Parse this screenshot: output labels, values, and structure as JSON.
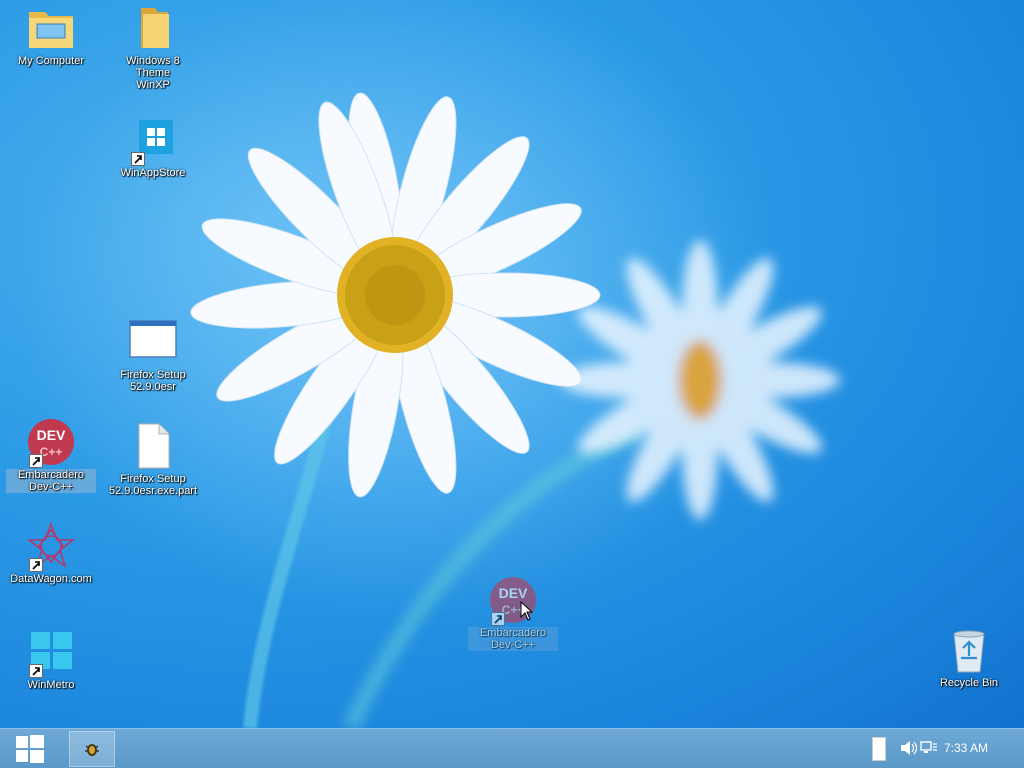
{
  "desktop": {
    "icons": {
      "my_computer": "My Computer",
      "win8_theme_line1": "Windows 8 Theme",
      "win8_theme_line2": "WinXP",
      "winappstore": "WinAppStore",
      "firefox_setup_line1": "Firefox Setup",
      "firefox_setup_line2": "52.9.0esr",
      "embarcadero_line1": "Embarcadero",
      "embarcadero_line2": "Dev-C++",
      "firefox_part_line1": "Firefox Setup",
      "firefox_part_line2": "52.9.0esr.exe.part",
      "datawagon": "DataWagon.com",
      "winmetro": "WinMetro",
      "dragged_embarcadero_line1": "Embarcadero",
      "dragged_embarcadero_line2": "Dev-C++",
      "recycle_bin": "Recycle Bin"
    },
    "devcpp_badge_text": "DEV",
    "devcpp_badge_sub": "C++"
  },
  "taskbar": {
    "clock": "7:33 AM"
  },
  "colors": {
    "desktop_blue": "#2c9be6",
    "taskbar_blue": "#5a98c8",
    "devcpp_red": "#c0394e"
  }
}
